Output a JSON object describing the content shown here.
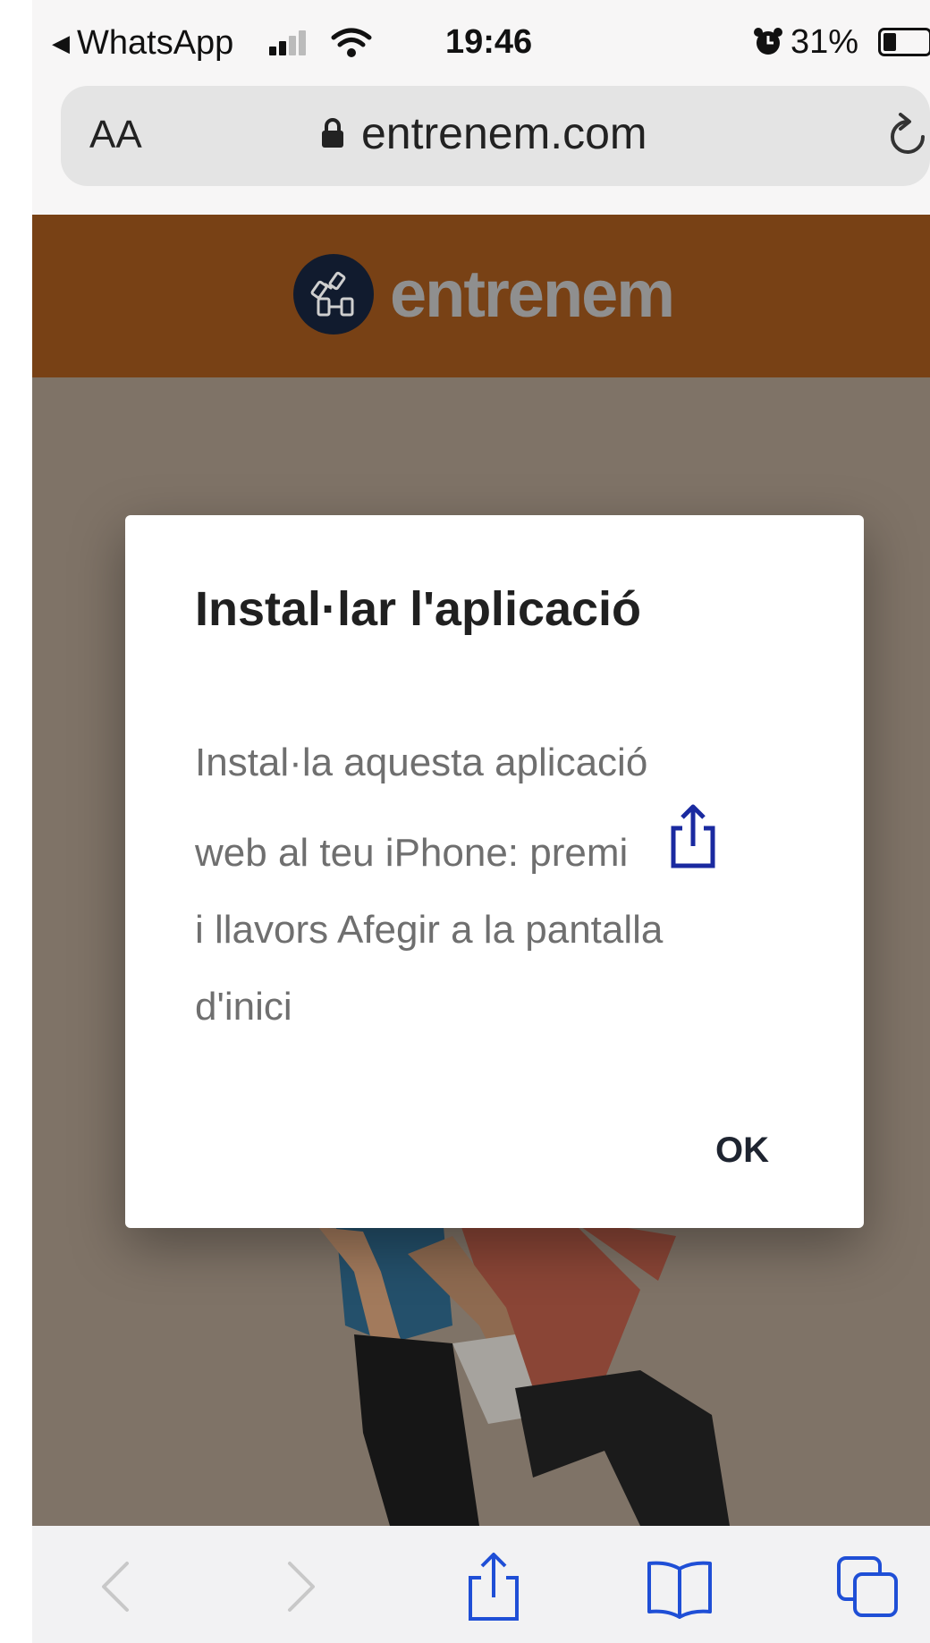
{
  "status_bar": {
    "back_app": "WhatsApp",
    "time": "19:46",
    "battery_percent": "31%"
  },
  "address_bar": {
    "text_size_label": "AA",
    "url": "entrenem.com"
  },
  "site": {
    "logo_text": "entrenem",
    "header_color": "#784115"
  },
  "dialog": {
    "title": "Instal·lar l'aplicació",
    "body_line1": "Instal·la aquesta aplicació",
    "body_line2": "web al teu iPhone: premi",
    "body_line3": "i llavors Afegir a la pantalla",
    "body_line4": "d'inici",
    "ok_label": "OK"
  },
  "toolbar": {
    "icons": [
      "back-icon",
      "forward-icon",
      "share-icon",
      "bookmarks-icon",
      "tabs-icon"
    ]
  }
}
